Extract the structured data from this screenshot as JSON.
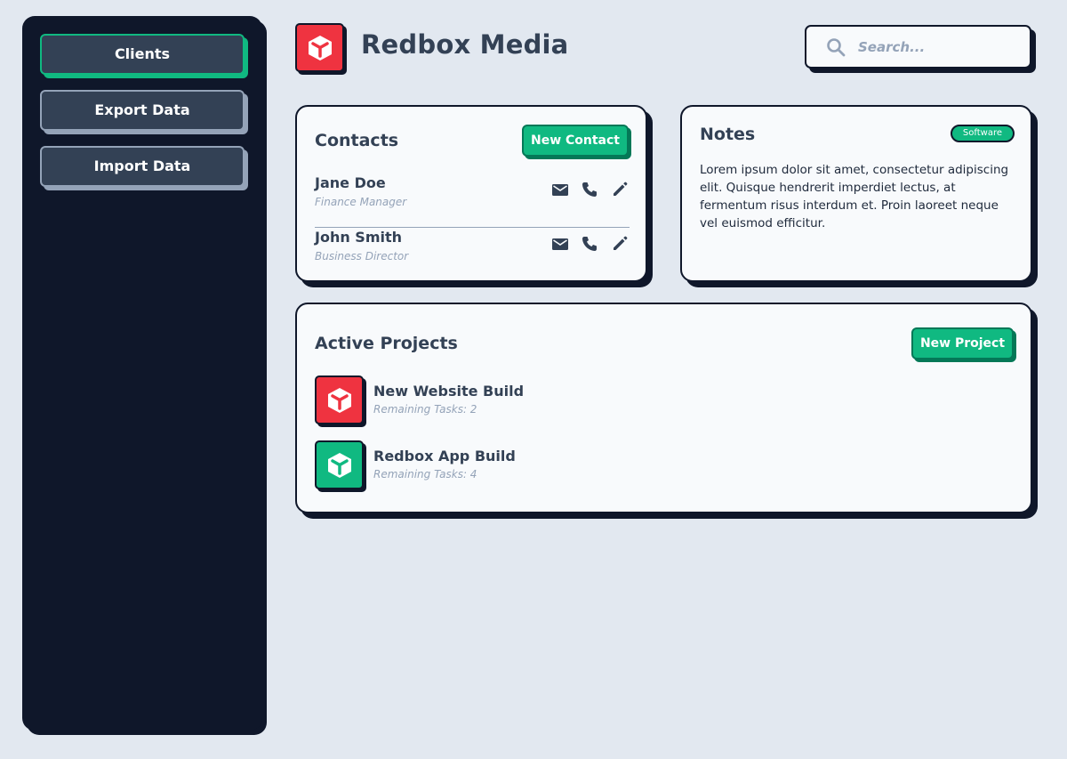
{
  "sidebar": {
    "items": [
      {
        "label": "Clients",
        "active": true
      },
      {
        "label": "Export Data",
        "active": false
      },
      {
        "label": "Import Data",
        "active": false
      }
    ]
  },
  "header": {
    "brand": "Redbox Media",
    "logo_icon": "cube-icon",
    "search_placeholder": "Search...",
    "search_icon": "search-icon"
  },
  "contacts": {
    "title": "Contacts",
    "new_button": "New Contact",
    "items": [
      {
        "name": "Jane Doe",
        "role": "Finance Manager"
      },
      {
        "name": "John Smith",
        "role": "Business Director"
      }
    ],
    "action_icons": [
      "mail-icon",
      "phone-icon",
      "edit-icon"
    ]
  },
  "notes": {
    "title": "Notes",
    "badge": "Software",
    "body": "Lorem ipsum dolor sit amet, consectetur adipiscing elit. Quisque hendrerit imperdiet lectus, at fermentum risus interdum et. Proin laoreet neque vel euismod efficitur."
  },
  "projects": {
    "title": "Active Projects",
    "new_button": "New Project",
    "items": [
      {
        "name": "New Website Build",
        "meta": "Remaining Tasks: 2",
        "color": "#ef3340"
      },
      {
        "name": "Redbox App Build",
        "meta": "Remaining Tasks: 4",
        "color": "#10b981"
      }
    ]
  },
  "colors": {
    "background": "#e2e8f0",
    "sidebar": "#0f172a",
    "accent_green": "#10b981",
    "brand_red": "#ef3340",
    "card": "#f8fafc"
  }
}
